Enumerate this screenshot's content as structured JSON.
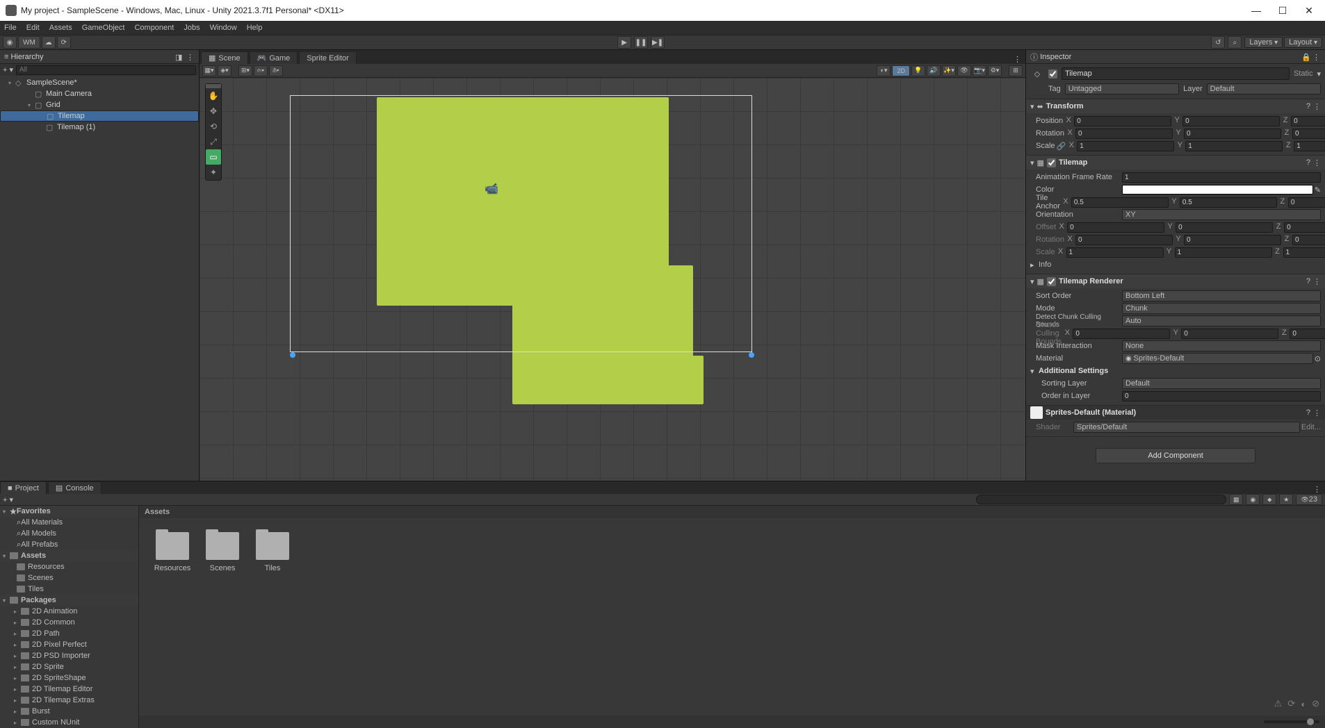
{
  "window": {
    "title": "My project - SampleScene - Windows, Mac, Linux - Unity 2021.3.7f1 Personal* <DX11>",
    "menu": [
      "File",
      "Edit",
      "Assets",
      "GameObject",
      "Component",
      "Jobs",
      "Window",
      "Help"
    ]
  },
  "toolbar": {
    "wm": "WM",
    "layers": "Layers",
    "layout": "Layout"
  },
  "hierarchy": {
    "title": "Hierarchy",
    "search_ph": "All",
    "items": [
      {
        "label": "SampleScene*",
        "depth": 0,
        "sel": false,
        "scene": true
      },
      {
        "label": "Main Camera",
        "depth": 1,
        "sel": false
      },
      {
        "label": "Grid",
        "depth": 1,
        "sel": false,
        "open": true
      },
      {
        "label": "Tilemap",
        "depth": 2,
        "sel": true
      },
      {
        "label": "Tilemap (1)",
        "depth": 2,
        "sel": false
      }
    ]
  },
  "center": {
    "tabs": [
      {
        "label": "Scene",
        "active": true
      },
      {
        "label": "Game",
        "active": false
      },
      {
        "label": "Sprite Editor",
        "active": false
      }
    ],
    "badge2d": "2D"
  },
  "inspector": {
    "title": "Inspector",
    "obj_name": "Tilemap",
    "static": "Static",
    "tag_lbl": "Tag",
    "tag_val": "Untagged",
    "layer_lbl": "Layer",
    "layer_val": "Default",
    "transform": {
      "title": "Transform",
      "position": {
        "lbl": "Position",
        "x": "0",
        "y": "0",
        "z": "0"
      },
      "rotation": {
        "lbl": "Rotation",
        "x": "0",
        "y": "0",
        "z": "0"
      },
      "scale": {
        "lbl": "Scale",
        "x": "1",
        "y": "1",
        "z": "1"
      }
    },
    "tilemap": {
      "title": "Tilemap",
      "anim_rate_lbl": "Animation Frame Rate",
      "anim_rate": "1",
      "color_lbl": "Color",
      "anchor_lbl": "Tile Anchor",
      "anchor": {
        "x": "0.5",
        "y": "0.5",
        "z": "0"
      },
      "orient_lbl": "Orientation",
      "orient": "XY",
      "offset_lbl": "Offset",
      "offset": {
        "x": "0",
        "y": "0",
        "z": "0"
      },
      "rotation_lbl": "Rotation",
      "rotation": {
        "x": "0",
        "y": "0",
        "z": "0"
      },
      "scale_lbl": "Scale",
      "scale": {
        "x": "1",
        "y": "1",
        "z": "1"
      },
      "info_lbl": "Info"
    },
    "renderer": {
      "title": "Tilemap Renderer",
      "sort_lbl": "Sort Order",
      "sort": "Bottom Left",
      "mode_lbl": "Mode",
      "mode": "Chunk",
      "detect_lbl": "Detect Chunk Culling Bounds",
      "detect": "Auto",
      "cull_lbl": "Chunk Culling Bounds",
      "cull": {
        "x": "0",
        "y": "0",
        "z": "0"
      },
      "mask_lbl": "Mask Interaction",
      "mask": "None",
      "mat_lbl": "Material",
      "mat": "Sprites-Default",
      "addl": "Additional Settings",
      "sortlayer_lbl": "Sorting Layer",
      "sortlayer": "Default",
      "order_lbl": "Order in Layer",
      "order": "0"
    },
    "material": {
      "title": "Sprites-Default (Material)",
      "shader_lbl": "Shader",
      "shader": "Sprites/Default",
      "edit": "Edit..."
    },
    "add_component": "Add Component"
  },
  "project": {
    "tabs": [
      {
        "label": "Project",
        "active": true
      },
      {
        "label": "Console",
        "active": false
      }
    ],
    "search_ph": "",
    "count_badge": "23",
    "fav_hdr": "Favorites",
    "favs": [
      "All Materials",
      "All Models",
      "All Prefabs"
    ],
    "assets_hdr": "Assets",
    "assets": [
      "Resources",
      "Scenes",
      "Tiles"
    ],
    "packages_hdr": "Packages",
    "packages": [
      "2D Animation",
      "2D Common",
      "2D Path",
      "2D Pixel Perfect",
      "2D PSD Importer",
      "2D Sprite",
      "2D SpriteShape",
      "2D Tilemap Editor",
      "2D Tilemap Extras",
      "Burst",
      "Custom NUnit"
    ],
    "breadcrumb": "Assets",
    "folders": [
      "Resources",
      "Scenes",
      "Tiles"
    ]
  }
}
